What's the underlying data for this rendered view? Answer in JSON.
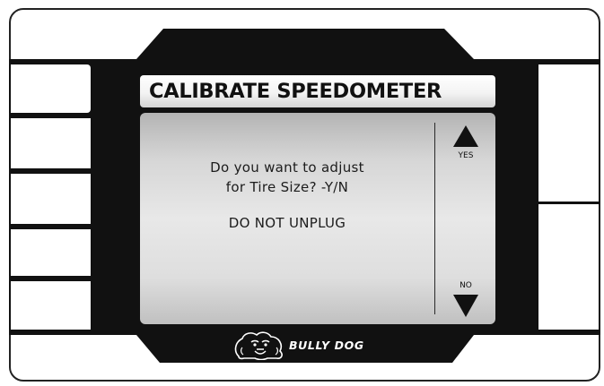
{
  "screen": {
    "title": "CALIBRATE SPEEDOMETER",
    "prompt_line1": "Do you want to adjust",
    "prompt_line2": "for Tire Size? -Y/N",
    "warning": "DO NOT UNPLUG"
  },
  "softkeys": {
    "yes_label": "YES",
    "no_label": "NO"
  },
  "brand": {
    "name": "BULLY DOG",
    "logo_icon": "bulldog-logo-icon"
  },
  "colors": {
    "bezel": "#111111",
    "screen_bg": "#dcdcdc",
    "text": "#1c1c1c"
  }
}
